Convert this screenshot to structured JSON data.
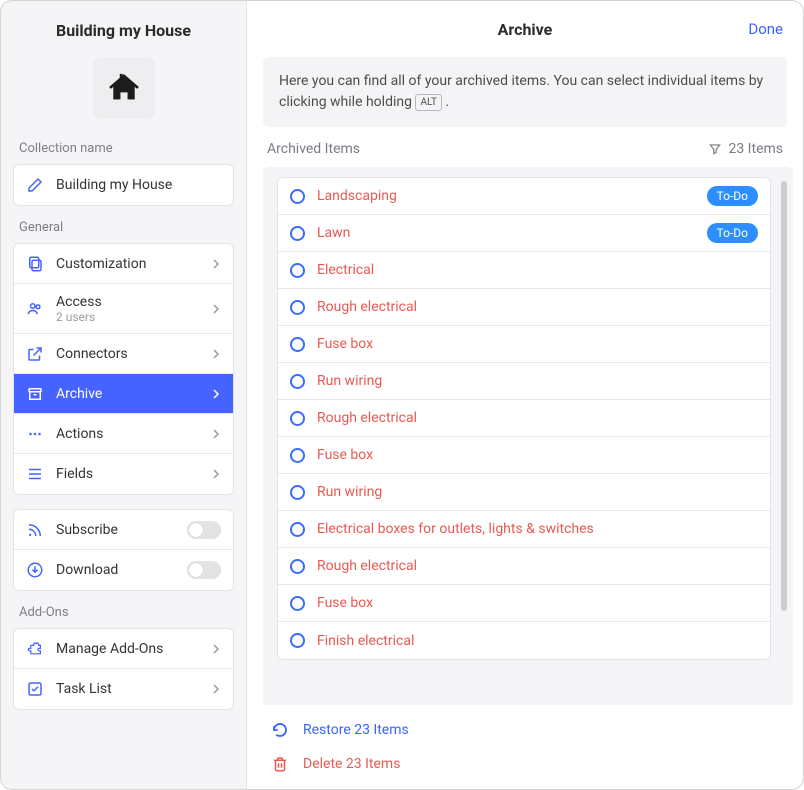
{
  "sidebar": {
    "title": "Building my House",
    "collection_label": "Collection name",
    "collection_value": "Building my House",
    "general_label": "General",
    "items": {
      "customization": "Customization",
      "access": "Access",
      "access_sub": "2 users",
      "connectors": "Connectors",
      "archive": "Archive",
      "actions": "Actions",
      "fields": "Fields"
    },
    "subscribe": "Subscribe",
    "download": "Download",
    "addons_label": "Add-Ons",
    "manage_addons": "Manage Add-Ons",
    "task_list": "Task List"
  },
  "main": {
    "title": "Archive",
    "done": "Done",
    "info_before": "Here you can find all of your archived items. You can select individual items by clicking while holding ",
    "info_key": "ALT",
    "info_after": " .",
    "list_title": "Archived Items",
    "count_text": "23 Items",
    "badge_todo": "To-Do",
    "restore": "Restore 23 Items",
    "delete": "Delete 23 Items",
    "items": [
      {
        "label": "Landscaping",
        "badge": true
      },
      {
        "label": "Lawn",
        "badge": true
      },
      {
        "label": "Electrical"
      },
      {
        "label": "Rough electrical"
      },
      {
        "label": "Fuse box"
      },
      {
        "label": "Run wiring"
      },
      {
        "label": "Rough electrical"
      },
      {
        "label": "Fuse box"
      },
      {
        "label": "Run wiring"
      },
      {
        "label": "Electrical boxes for outlets, lights & switches"
      },
      {
        "label": "Rough electrical"
      },
      {
        "label": "Fuse box"
      },
      {
        "label": "Finish electrical"
      }
    ]
  }
}
